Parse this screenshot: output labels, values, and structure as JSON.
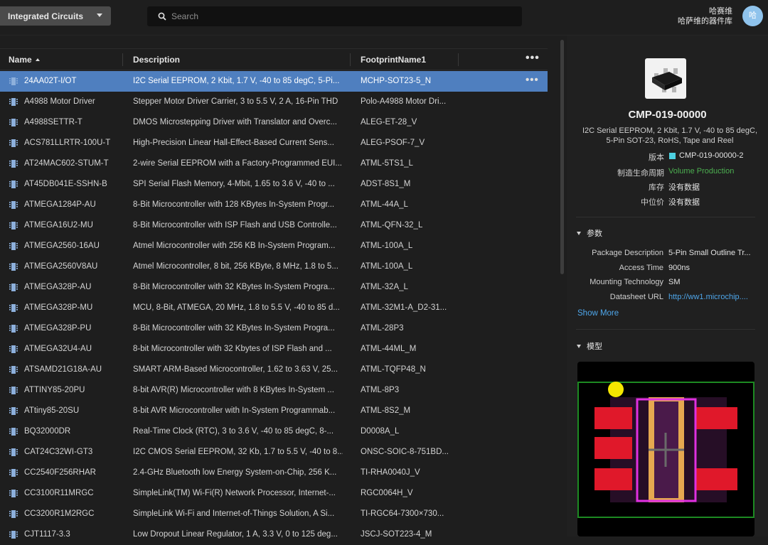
{
  "header": {
    "library": "Integrated Circuits",
    "search_placeholder": "Search",
    "user_name": "哈赛维",
    "user_library": "哈萨维的器件库",
    "avatar_initial": "哈"
  },
  "table": {
    "columns": [
      "Name",
      "Description",
      "FootprintName1"
    ],
    "sort_column": "Name",
    "rows": [
      {
        "name": "24AA02T-I/OT",
        "description": "I2C Serial EEPROM, 2 Kbit, 1.7 V, -40 to 85 degC, 5-Pi...",
        "footprint": "MCHP-SOT23-5_N",
        "selected": true
      },
      {
        "name": "A4988 Motor Driver",
        "description": "Stepper Motor Driver Carrier, 3 to 5.5 V, 2 A, 16-Pin THD",
        "footprint": "Polo-A4988 Motor Dri..."
      },
      {
        "name": "A4988SETTR-T",
        "description": "DMOS Microstepping Driver with Translator and Overc...",
        "footprint": "ALEG-ET-28_V"
      },
      {
        "name": "ACS781LLRTR-100U-T",
        "description": "High-Precision Linear Hall-Effect-Based Current Sens...",
        "footprint": "ALEG-PSOF-7_V"
      },
      {
        "name": "AT24MAC602-STUM-T",
        "description": "2-wire Serial EEPROM with a Factory-Programmed EUI...",
        "footprint": "ATML-5TS1_L"
      },
      {
        "name": "AT45DB041E-SSHN-B",
        "description": "SPI Serial Flash Memory, 4-Mbit, 1.65 to 3.6 V, -40 to ...",
        "footprint": "ADST-8S1_M"
      },
      {
        "name": "ATMEGA1284P-AU",
        "description": "8-Bit Microcontroller with 128 KBytes In-System Progr...",
        "footprint": "ATML-44A_L"
      },
      {
        "name": "ATMEGA16U2-MU",
        "description": "8-Bit Microcontroller with ISP Flash and USB Controlle...",
        "footprint": "ATML-QFN-32_L"
      },
      {
        "name": "ATMEGA2560-16AU",
        "description": "Atmel Microcontroller with 256 KB In-System Program...",
        "footprint": "ATML-100A_L"
      },
      {
        "name": "ATMEGA2560V8AU",
        "description": "Atmel Microcontroller, 8 bit, 256 KByte, 8 MHz, 1.8 to 5...",
        "footprint": "ATML-100A_L"
      },
      {
        "name": "ATMEGA328P-AU",
        "description": "8-Bit Microcontroller with 32 KBytes In-System Progra...",
        "footprint": "ATML-32A_L"
      },
      {
        "name": "ATMEGA328P-MU",
        "description": "MCU, 8-Bit, ATMEGA, 20 MHz, 1.8 to 5.5 V, -40 to 85 d...",
        "footprint": "ATML-32M1-A_D2-31..."
      },
      {
        "name": "ATMEGA328P-PU",
        "description": "8-Bit Microcontroller with 32 KBytes In-System Progra...",
        "footprint": "ATML-28P3"
      },
      {
        "name": "ATMEGA32U4-AU",
        "description": "8-bit Microcontroller with 32 Kbytes of ISP Flash and ...",
        "footprint": "ATML-44ML_M"
      },
      {
        "name": "ATSAMD21G18A-AU",
        "description": "SMART ARM-Based Microcontroller, 1.62 to 3.63 V, 25...",
        "footprint": "ATML-TQFP48_N"
      },
      {
        "name": "ATTINY85-20PU",
        "description": "8-bit AVR(R) Microcontroller with 8 KBytes In-System ...",
        "footprint": "ATML-8P3"
      },
      {
        "name": "ATtiny85-20SU",
        "description": "8-bit AVR Microcontroller with In-System Programmab...",
        "footprint": "ATML-8S2_M"
      },
      {
        "name": "BQ32000DR",
        "description": "Real-Time Clock (RTC), 3 to 3.6 V, -40 to 85 degC, 8-...",
        "footprint": "D0008A_L"
      },
      {
        "name": "CAT24C32WI-GT3",
        "description": "I2C CMOS Serial EEPROM, 32 Kb, 1.7 to 5.5 V, -40 to 8...",
        "footprint": "ONSC-SOIC-8-751BD..."
      },
      {
        "name": "CC2540F256RHAR",
        "description": "2.4-GHz Bluetooth low Energy System-on-Chip, 256 K...",
        "footprint": "TI-RHA0040J_V"
      },
      {
        "name": "CC3100R11MRGC",
        "description": "SimpleLink(TM) Wi-Fi(R) Network Processor, Internet-...",
        "footprint": "RGC0064H_V"
      },
      {
        "name": "CC3200R1M2RGC",
        "description": "SimpleLink Wi-Fi and Internet-of-Things Solution, A Si...",
        "footprint": "TI-RGC64-7300×730..."
      },
      {
        "name": "CJT1117-3.3",
        "description": "Low Dropout Linear Regulator, 1 A, 3.3 V, 0 to 125 deg...",
        "footprint": "JSCJ-SOT223-4_M"
      }
    ]
  },
  "detail": {
    "part_number": "CMP-019-00000",
    "description": "I2C Serial EEPROM, 2 Kbit, 1.7 V, -40 to 85 degC, 5-Pin SOT-23, RoHS, Tape and Reel",
    "info": [
      {
        "label": "版本",
        "value": "CMP-019-00000-2"
      },
      {
        "label": "制造生命周期",
        "value": "Volume Production"
      },
      {
        "label": "库存",
        "value": "没有数据"
      },
      {
        "label": "中位价",
        "value": "没有数据"
      }
    ],
    "params_title": "参数",
    "params": [
      {
        "label": "Package Description",
        "value": "5-Pin Small Outline Tr..."
      },
      {
        "label": "Access Time",
        "value": "900ns"
      },
      {
        "label": "Mounting Technology",
        "value": "SM"
      },
      {
        "label": "Datasheet URL",
        "value": "http://ww1.microchip...."
      }
    ],
    "show_more": "Show More",
    "model_title": "模型"
  },
  "colors": {
    "selected_row": "#4f7fbf",
    "version_swatch": "#4dd0e1",
    "lifecycle_ok": "#4caf50",
    "link": "#4ea6ea",
    "pad_red": "#e0182a",
    "silk_yellow": "#f5c200",
    "outline_magenta": "#e030e0",
    "board_green": "#1d8a22"
  }
}
